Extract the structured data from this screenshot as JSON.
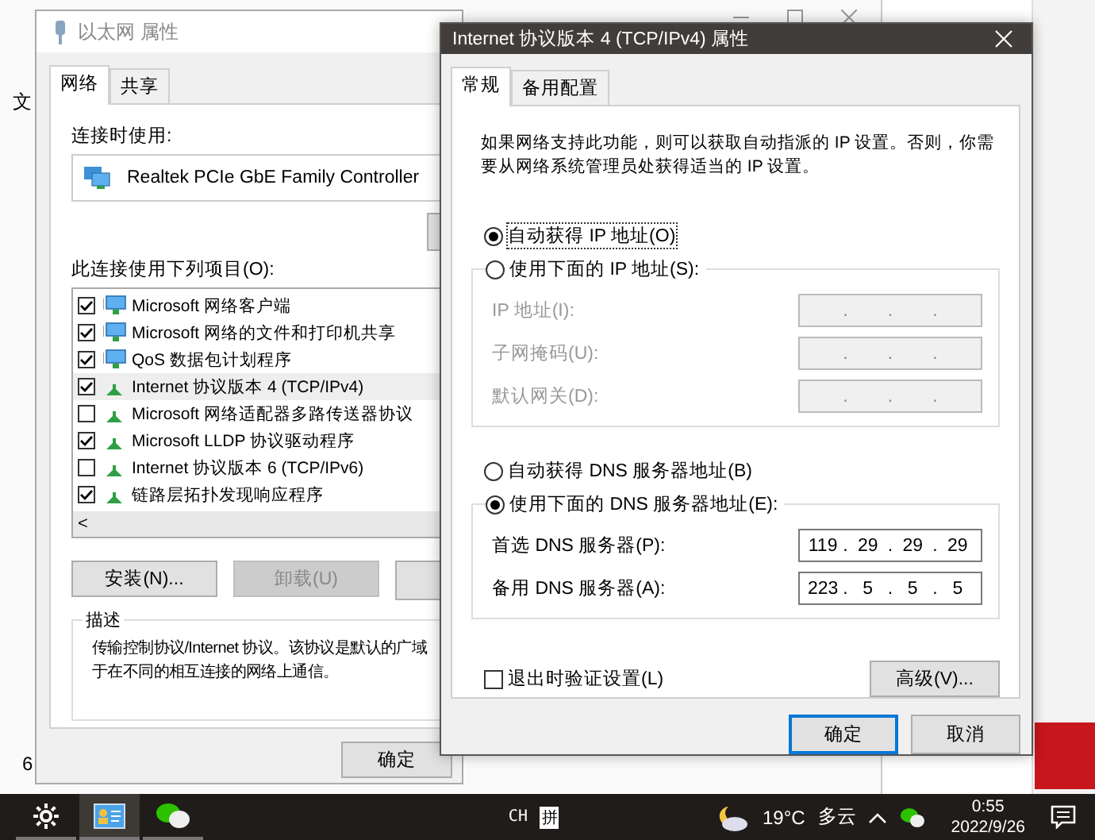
{
  "background_window": {
    "menu_text": "文",
    "footer_text": "6"
  },
  "ethernet_window": {
    "title": "以太网 属性",
    "tabs": [
      {
        "label": "网络",
        "selected": true
      },
      {
        "label": "共享",
        "selected": false
      }
    ],
    "connect_using_label": "连接时使用:",
    "adapter": "Realtek PCIe GbE Family Controller",
    "items_label": "此连接使用下列项目(O):",
    "items": [
      {
        "label": "Microsoft 网络客户端",
        "checked": true,
        "selected": false,
        "kind": "client"
      },
      {
        "label": "Microsoft 网络的文件和打印机共享",
        "checked": true,
        "selected": false,
        "kind": "client"
      },
      {
        "label": "QoS 数据包计划程序",
        "checked": true,
        "selected": false,
        "kind": "client"
      },
      {
        "label": "Internet 协议版本 4 (TCP/IPv4)",
        "checked": true,
        "selected": true,
        "kind": "protocol"
      },
      {
        "label": "Microsoft 网络适配器多路传送器协议",
        "checked": false,
        "selected": false,
        "kind": "protocol"
      },
      {
        "label": "Microsoft LLDP 协议驱动程序",
        "checked": true,
        "selected": false,
        "kind": "protocol"
      },
      {
        "label": "Internet 协议版本 6 (TCP/IPv6)",
        "checked": false,
        "selected": false,
        "kind": "protocol"
      },
      {
        "label": "链路层拓扑发现响应程序",
        "checked": true,
        "selected": false,
        "kind": "protocol"
      }
    ],
    "scroll_left": "<",
    "buttons": [
      {
        "label": "安装(N)...",
        "disabled": false
      },
      {
        "label": "卸载(U)",
        "disabled": true
      }
    ],
    "description": {
      "legend": "描述",
      "lines": [
        "传输控制协议/Internet 协议。该协议是默认的广域",
        "于在不同的相互连接的网络上通信。"
      ]
    },
    "ok_button": "确定"
  },
  "ipv4_dialog": {
    "title": "Internet 协议版本 4 (TCP/IPv4) 属性",
    "tabs": [
      {
        "label": "常规",
        "selected": true
      },
      {
        "label": "备用配置",
        "selected": false
      }
    ],
    "intro": "如果网络支持此功能，则可以获取自动指派的 IP 设置。否则，你需要从网络系统管理员处获得适当的 IP 设置。",
    "separator": ".",
    "ip_modes": [
      {
        "label": "自动获得 IP 地址(O)",
        "selected": true
      },
      {
        "label": "使用下面的 IP 地址(S):",
        "selected": false
      }
    ],
    "ip_fields": [
      {
        "label": "IP 地址(I):",
        "disabled": true
      },
      {
        "label": "子网掩码(U):",
        "disabled": true
      },
      {
        "label": "默认网关(D):",
        "disabled": true
      }
    ],
    "dns_modes": [
      {
        "label": "自动获得 DNS 服务器地址(B)",
        "selected": false
      },
      {
        "label": "使用下面的 DNS 服务器地址(E):",
        "selected": true
      }
    ],
    "dns_fields": [
      {
        "label": "首选 DNS 服务器(P):",
        "disabled": false,
        "octets": [
          "119",
          "29",
          "29",
          "29"
        ]
      },
      {
        "label": "备用 DNS 服务器(A):",
        "disabled": false,
        "octets": [
          "223",
          "5",
          "5",
          "5"
        ]
      }
    ],
    "validate": {
      "label": "退出时验证设置(L)",
      "checked": false
    },
    "advanced_button": "高级(V)...",
    "buttons": [
      {
        "label": "确定",
        "default": true
      },
      {
        "label": "取消",
        "default": false
      }
    ]
  },
  "taskbar": {
    "apps": [
      {
        "kind": "settings",
        "active": false
      },
      {
        "kind": "contacts",
        "active": true
      },
      {
        "kind": "wechat",
        "active": false
      }
    ],
    "ime": [
      "CH",
      "拼"
    ],
    "weather": {
      "temperature": "19°C",
      "condition": "多云"
    },
    "clock": {
      "time": "0:55",
      "date": "2022/9/26"
    }
  }
}
